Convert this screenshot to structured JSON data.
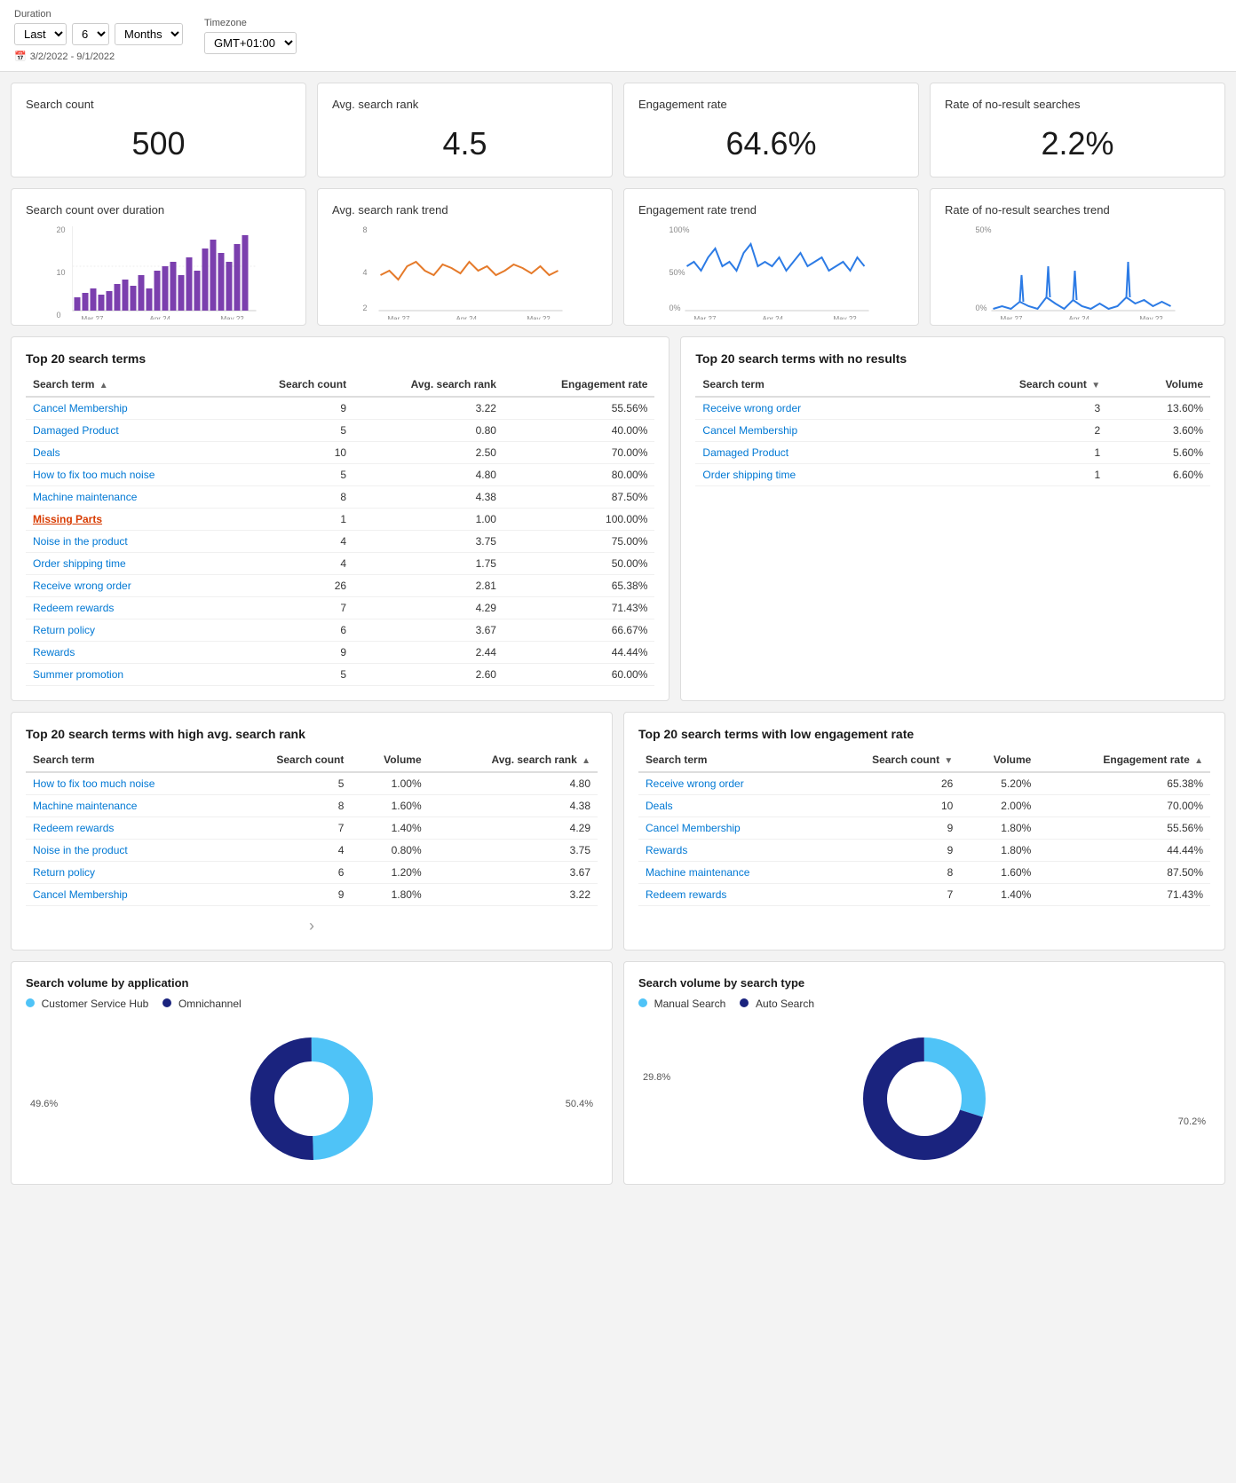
{
  "header": {
    "duration_label": "Duration",
    "timezone_label": "Timezone",
    "duration_prefix": "Last",
    "duration_value": "6",
    "duration_unit": "Months",
    "timezone_value": "GMT+01:00",
    "date_range_icon": "📅",
    "date_range": "3/2/2022 - 9/1/2022"
  },
  "kpis": [
    {
      "title": "Search count",
      "value": "500"
    },
    {
      "title": "Avg. search rank",
      "value": "4.5"
    },
    {
      "title": "Engagement rate",
      "value": "64.6%"
    },
    {
      "title": "Rate of no-result searches",
      "value": "2.2%"
    }
  ],
  "charts": [
    {
      "title": "Search count over duration",
      "type": "bar",
      "color": "#7B3FAE",
      "xLabels": [
        "Mar 27",
        "Apr 24",
        "May 22"
      ],
      "yMax": 20,
      "yMid": 10,
      "yMin": 0
    },
    {
      "title": "Avg. search rank trend",
      "type": "line",
      "color": "#E57A2A",
      "xLabels": [
        "Mar 27",
        "Apr 24",
        "May 22"
      ],
      "yMax": 8,
      "yMid": 4,
      "yMin": 2
    },
    {
      "title": "Engagement rate trend",
      "type": "line",
      "color": "#2C7BE5",
      "xLabels": [
        "Mar 27",
        "Apr 24",
        "May 22"
      ],
      "yMax": "100%",
      "yMid": "50%",
      "yMin": "0%"
    },
    {
      "title": "Rate of no-result searches trend",
      "type": "line",
      "color": "#2C7BE5",
      "xLabels": [
        "Mar 27",
        "Apr 24",
        "May 22"
      ],
      "yMax": "50%",
      "yMid": "",
      "yMin": "0%"
    }
  ],
  "top20_terms": {
    "title": "Top 20 search terms",
    "columns": [
      "Search term",
      "Search count",
      "Avg. search rank",
      "Engagement rate"
    ],
    "rows": [
      {
        "term": "Cancel Membership",
        "count": "9",
        "rank": "3.22",
        "engagement": "55.56%",
        "highlight": false
      },
      {
        "term": "Damaged Product",
        "count": "5",
        "rank": "0.80",
        "engagement": "40.00%",
        "highlight": false
      },
      {
        "term": "Deals",
        "count": "10",
        "rank": "2.50",
        "engagement": "70.00%",
        "highlight": false
      },
      {
        "term": "How to fix too much noise",
        "count": "5",
        "rank": "4.80",
        "engagement": "80.00%",
        "highlight": false
      },
      {
        "term": "Machine maintenance",
        "count": "8",
        "rank": "4.38",
        "engagement": "87.50%",
        "highlight": false
      },
      {
        "term": "Missing Parts",
        "count": "1",
        "rank": "1.00",
        "engagement": "100.00%",
        "highlight": true
      },
      {
        "term": "Noise in the product",
        "count": "4",
        "rank": "3.75",
        "engagement": "75.00%",
        "highlight": false
      },
      {
        "term": "Order shipping time",
        "count": "4",
        "rank": "1.75",
        "engagement": "50.00%",
        "highlight": false
      },
      {
        "term": "Receive wrong order",
        "count": "26",
        "rank": "2.81",
        "engagement": "65.38%",
        "highlight": false
      },
      {
        "term": "Redeem rewards",
        "count": "7",
        "rank": "4.29",
        "engagement": "71.43%",
        "highlight": false
      },
      {
        "term": "Return policy",
        "count": "6",
        "rank": "3.67",
        "engagement": "66.67%",
        "highlight": false
      },
      {
        "term": "Rewards",
        "count": "9",
        "rank": "2.44",
        "engagement": "44.44%",
        "highlight": false
      },
      {
        "term": "Summer promotion",
        "count": "5",
        "rank": "2.60",
        "engagement": "60.00%",
        "highlight": false
      }
    ]
  },
  "no_results_terms": {
    "title": "Top 20 search terms with no results",
    "columns": [
      "Search term",
      "Search count",
      "Volume"
    ],
    "rows": [
      {
        "term": "Receive wrong order",
        "count": "3",
        "volume": "13.60%"
      },
      {
        "term": "Cancel Membership",
        "count": "2",
        "volume": "3.60%"
      },
      {
        "term": "Damaged Product",
        "count": "1",
        "volume": "5.60%"
      },
      {
        "term": "Order shipping time",
        "count": "1",
        "volume": "6.60%"
      }
    ]
  },
  "high_rank_terms": {
    "title": "Top 20 search terms with high avg. search rank",
    "columns": [
      "Search term",
      "Search count",
      "Volume",
      "Avg. search rank"
    ],
    "rows": [
      {
        "term": "How to fix too much noise",
        "count": "5",
        "volume": "1.00%",
        "rank": "4.80"
      },
      {
        "term": "Machine maintenance",
        "count": "8",
        "volume": "1.60%",
        "rank": "4.38"
      },
      {
        "term": "Redeem rewards",
        "count": "7",
        "volume": "1.40%",
        "rank": "4.29"
      },
      {
        "term": "Noise in the product",
        "count": "4",
        "volume": "0.80%",
        "rank": "3.75"
      },
      {
        "term": "Return policy",
        "count": "6",
        "volume": "1.20%",
        "rank": "3.67"
      },
      {
        "term": "Cancel Membership",
        "count": "9",
        "volume": "1.80%",
        "rank": "3.22"
      }
    ]
  },
  "low_engagement_terms": {
    "title": "Top 20 search terms with low engagement rate",
    "columns": [
      "Search term",
      "Search count",
      "Volume",
      "Engagement rate"
    ],
    "rows": [
      {
        "term": "Receive wrong order",
        "count": "26",
        "volume": "5.20%",
        "engagement": "65.38%"
      },
      {
        "term": "Deals",
        "count": "10",
        "volume": "2.00%",
        "engagement": "70.00%"
      },
      {
        "term": "Cancel Membership",
        "count": "9",
        "volume": "1.80%",
        "engagement": "55.56%"
      },
      {
        "term": "Rewards",
        "count": "9",
        "volume": "1.80%",
        "engagement": "44.44%"
      },
      {
        "term": "Machine maintenance",
        "count": "8",
        "volume": "1.60%",
        "engagement": "87.50%"
      },
      {
        "term": "Redeem rewards",
        "count": "7",
        "volume": "1.40%",
        "engagement": "71.43%"
      }
    ]
  },
  "donut_app": {
    "title": "Search volume by application",
    "legend": [
      {
        "label": "Customer Service Hub",
        "color": "#4FC3F7"
      },
      {
        "label": "Omnichannel",
        "color": "#1A237E"
      }
    ],
    "slices": [
      {
        "value": 49.6,
        "color": "#4FC3F7",
        "label": "49.6%"
      },
      {
        "value": 50.4,
        "color": "#1A237E",
        "label": "50.4%"
      }
    ]
  },
  "donut_type": {
    "title": "Search volume by search type",
    "legend": [
      {
        "label": "Manual Search",
        "color": "#4FC3F7"
      },
      {
        "label": "Auto Search",
        "color": "#1A237E"
      }
    ],
    "slices": [
      {
        "value": 29.8,
        "color": "#4FC3F7",
        "label": "29.8%"
      },
      {
        "value": 70.2,
        "color": "#1A237E",
        "label": "70.2%"
      }
    ]
  }
}
